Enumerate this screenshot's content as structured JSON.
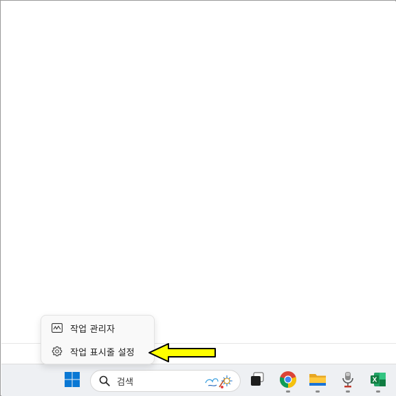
{
  "context_menu": {
    "items": [
      {
        "label": "작업 관리자",
        "icon": "task-manager-icon"
      },
      {
        "label": "작업 표시줄 설정",
        "icon": "gear-icon"
      }
    ]
  },
  "annotation": {
    "arrow_color": "#ffff00",
    "arrow_outline": "#000000"
  },
  "taskbar": {
    "search": {
      "placeholder": "검색"
    },
    "apps": [
      {
        "name": "start",
        "icon": "windows-logo-icon"
      },
      {
        "name": "task-view",
        "icon": "task-view-icon"
      },
      {
        "name": "chrome",
        "icon": "chrome-icon"
      },
      {
        "name": "file-explorer",
        "icon": "folder-icon"
      },
      {
        "name": "microphone-app",
        "icon": "microphone-icon"
      },
      {
        "name": "excel",
        "icon": "excel-icon",
        "letter": "X"
      }
    ],
    "accent": "#0067c0"
  }
}
